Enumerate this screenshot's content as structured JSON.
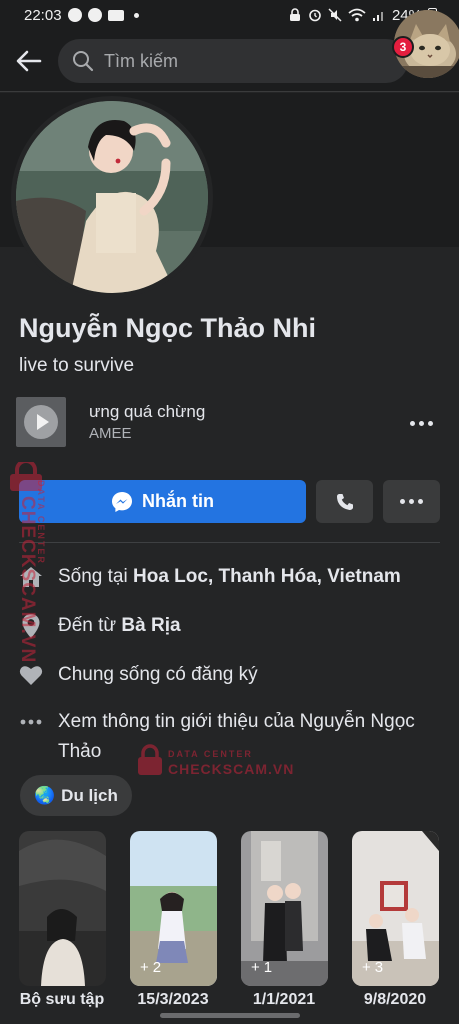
{
  "status_bar": {
    "time": "22:03",
    "battery": "24%"
  },
  "search": {
    "placeholder": "Tìm kiếm",
    "notification_count": "3"
  },
  "profile": {
    "name": "Nguyễn Ngọc Thảo Nhi",
    "bio": "live to survive"
  },
  "music": {
    "title": "ưng quá chừng",
    "artist": "AMEE"
  },
  "actions": {
    "message_label": "Nhắn tin"
  },
  "info": [
    {
      "prefix": "Sống tại ",
      "bold": "Hoa Loc, Thanh Hóa, Vietnam",
      "icon": "home-icon"
    },
    {
      "prefix": "Đến từ ",
      "bold": "Bà Rịa",
      "icon": "location-pin-icon"
    },
    {
      "prefix": "Chung sống có đăng ký",
      "bold": "",
      "icon": "heart-icon"
    },
    {
      "prefix": "Xem thông tin giới thiệu của Nguyễn Ngọc Thảo",
      "bold": "",
      "icon": "more-dots-icon"
    }
  ],
  "hobby": {
    "label": "Du lịch",
    "emoji": "🌏"
  },
  "highlights": [
    {
      "label": "Bộ sưu tập",
      "count": ""
    },
    {
      "label": "15/3/2023",
      "count": "2"
    },
    {
      "label": "1/1/2021",
      "count": "1"
    },
    {
      "label": "9/8/2020",
      "count": "3"
    }
  ],
  "watermark": {
    "vertical": "CHECKSCAM.VN",
    "vertical_sub": "DATA CENTER",
    "center": "CHECKSCAM.VN",
    "center_sub": "DATA CENTER"
  },
  "colors": {
    "background": "#242526",
    "accent": "#2374e1",
    "badge": "#e41e3f"
  }
}
